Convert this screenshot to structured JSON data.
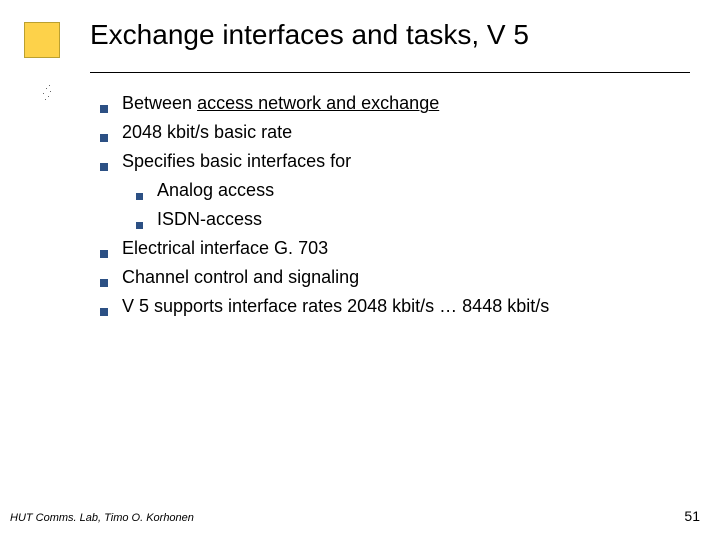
{
  "title": "Exchange interfaces and tasks, V 5",
  "bullets": {
    "b0_pre": "Between ",
    "b0_u": "access network and exchange",
    "b1": "2048 kbit/s basic rate",
    "b2": "Specifies basic interfaces for",
    "b2a": "Analog access",
    "b2b": "ISDN-access",
    "b3": "Electrical interface G. 703",
    "b4": "Channel control and signaling",
    "b5": "V 5 supports interface rates 2048 kbit/s … 8448 kbit/s"
  },
  "footer": {
    "left": "HUT Comms. Lab, Timo O. Korhonen",
    "page": "51"
  }
}
